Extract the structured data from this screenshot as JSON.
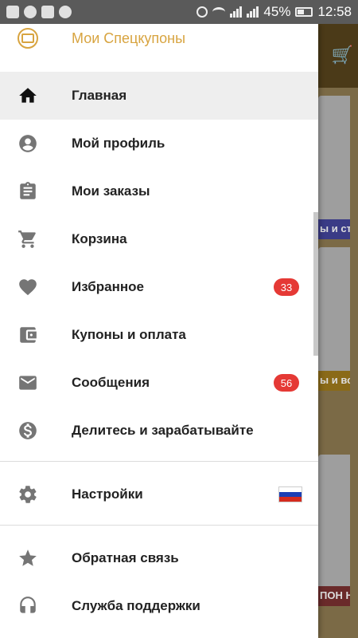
{
  "status_bar": {
    "battery_percent": "45%",
    "time": "12:58",
    "left_icons": [
      "facebook-icon",
      "whatsapp-icon",
      "image-icon",
      "more-icon"
    ],
    "right_icons": [
      "alarm-icon",
      "wifi-icon",
      "signal-icon",
      "signal-icon",
      "battery-icon"
    ]
  },
  "drawer": {
    "coupon_label": "Мои Спецкупоны",
    "items": [
      {
        "label": "Главная",
        "icon": "home-icon",
        "active": true
      },
      {
        "label": "Мой профиль",
        "icon": "account-icon"
      },
      {
        "label": "Мои заказы",
        "icon": "clipboard-icon"
      },
      {
        "label": "Корзина",
        "icon": "cart-icon"
      },
      {
        "label": "Избранное",
        "icon": "heart-icon",
        "badge": "33"
      },
      {
        "label": "Купоны и оплата",
        "icon": "wallet-icon"
      },
      {
        "label": "Сообщения",
        "icon": "mail-icon",
        "badge": "56"
      },
      {
        "label": "Делитесь и зарабатывайте",
        "icon": "dollar-icon"
      },
      {
        "label": "Настройки",
        "icon": "gear-icon",
        "flag": "ru"
      },
      {
        "label": "Обратная связь",
        "icon": "star-icon"
      },
      {
        "label": "Служба поддержки",
        "icon": "headset-icon"
      }
    ]
  },
  "background": {
    "labels": [
      "ы и сть",
      "ы и во",
      "ПОН НЯ"
    ]
  },
  "colors": {
    "accent": "#d8a440",
    "badge": "#e53935",
    "active_bg": "#eeeeee"
  }
}
